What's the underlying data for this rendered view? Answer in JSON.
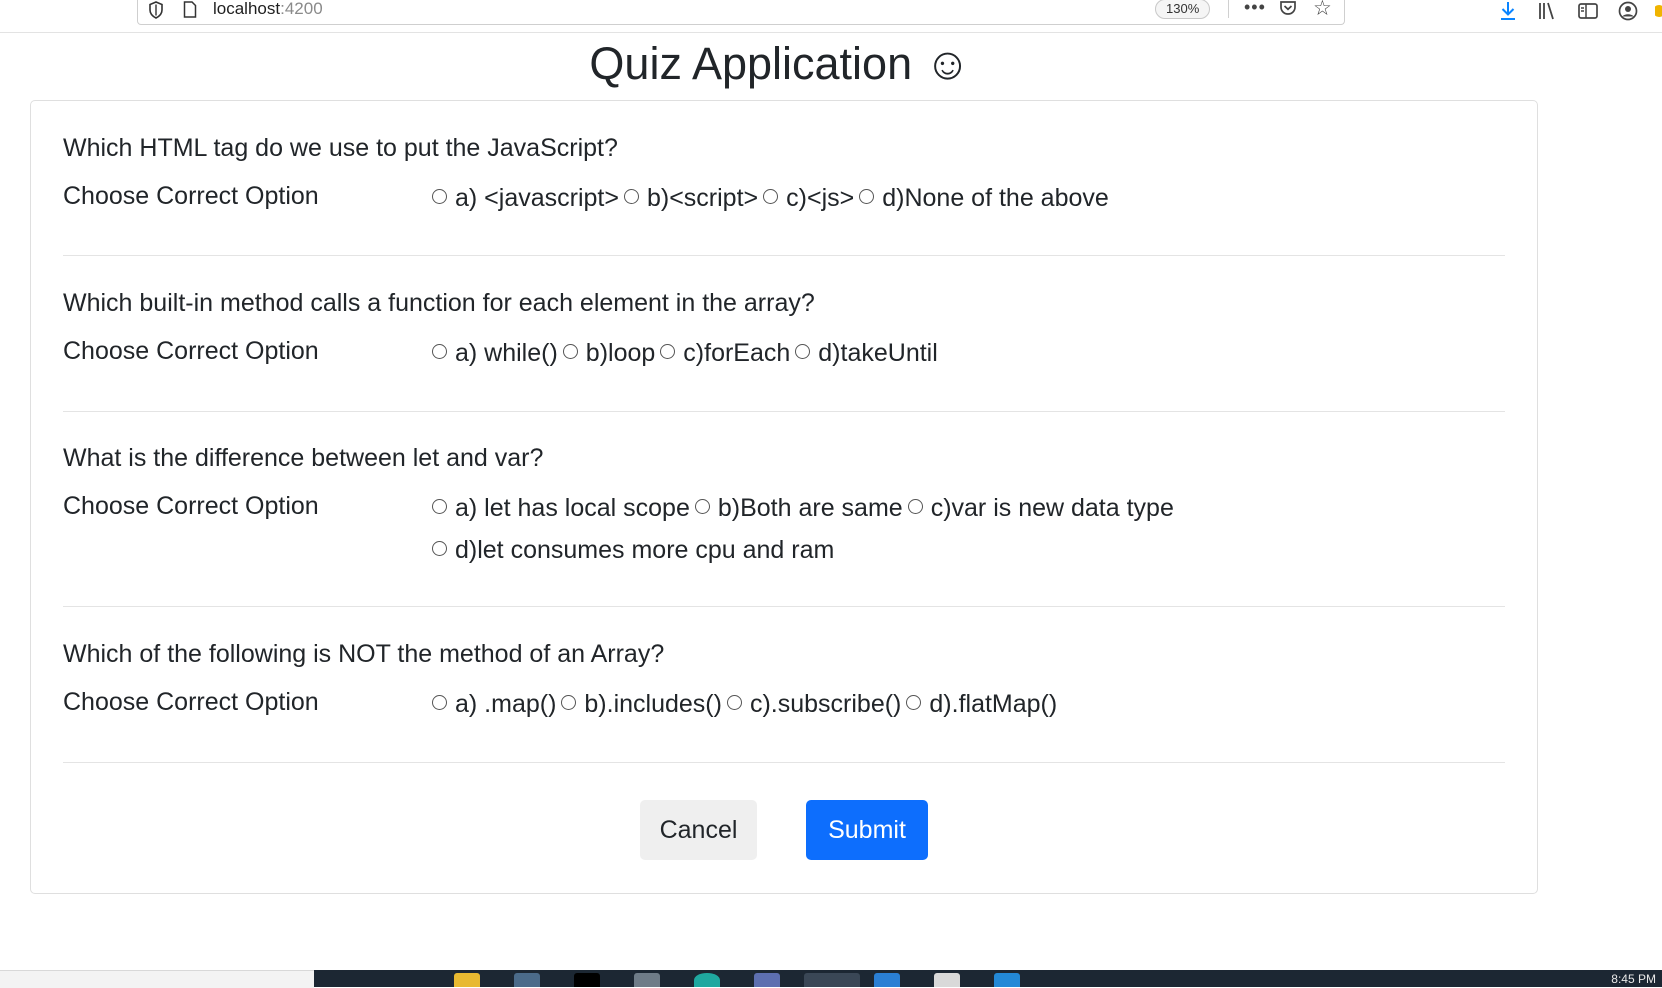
{
  "browser": {
    "url_host": "localhost",
    "url_port": ":4200",
    "zoom": "130%"
  },
  "page": {
    "title": "Quiz Application ☺"
  },
  "questions": [
    {
      "text": "Which HTML tag do we use to put the JavaScript?",
      "choose_label": "Choose Correct Option",
      "options": [
        "a) <javascript>",
        "b)<script>",
        "c)<js>",
        "d)None of the above"
      ]
    },
    {
      "text": "Which built-in method calls a function for each element in the array?",
      "choose_label": "Choose Correct Option",
      "options": [
        "a) while()",
        "b)loop",
        "c)forEach",
        "d)takeUntil"
      ]
    },
    {
      "text": "What is the difference between let and var?",
      "choose_label": "Choose Correct Option",
      "options": [
        "a) let has local scope",
        "b)Both are same",
        "c)var is new data type",
        "d)let consumes more cpu and ram"
      ]
    },
    {
      "text": "Which of the following is NOT the method of an Array?",
      "choose_label": "Choose Correct Option",
      "options": [
        "a) .map()",
        "b).includes()",
        "c).subscribe()",
        "d).flatMap()"
      ]
    }
  ],
  "actions": {
    "cancel_label": "Cancel",
    "submit_label": "Submit"
  },
  "taskbar": {
    "clock": "8:45 PM"
  },
  "colors": {
    "primary": "#0d6efd",
    "secondary_button": "#efefef",
    "taskbar": "#1c2733"
  }
}
